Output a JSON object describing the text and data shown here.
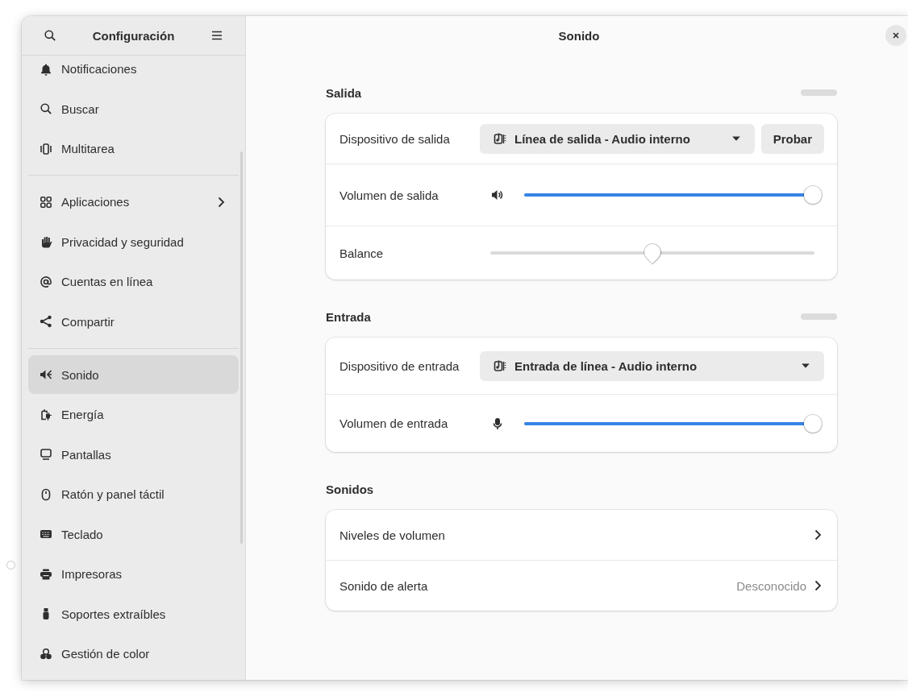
{
  "sidebar": {
    "title": "Configuración",
    "groups": [
      {
        "items": [
          {
            "label": "Notificaciones",
            "selected": false,
            "submenu": false
          },
          {
            "label": "Buscar",
            "selected": false,
            "submenu": false
          },
          {
            "label": "Multitarea",
            "selected": false,
            "submenu": false
          }
        ]
      },
      {
        "items": [
          {
            "label": "Aplicaciones",
            "selected": false,
            "submenu": true
          },
          {
            "label": "Privacidad y seguridad",
            "selected": false,
            "submenu": false
          },
          {
            "label": "Cuentas en línea",
            "selected": false,
            "submenu": false
          },
          {
            "label": "Compartir",
            "selected": false,
            "submenu": false
          }
        ]
      },
      {
        "items": [
          {
            "label": "Sonido",
            "selected": true,
            "submenu": false
          },
          {
            "label": "Energía",
            "selected": false,
            "submenu": false
          },
          {
            "label": "Pantallas",
            "selected": false,
            "submenu": false
          },
          {
            "label": "Ratón y panel táctil",
            "selected": false,
            "submenu": false
          },
          {
            "label": "Teclado",
            "selected": false,
            "submenu": false
          },
          {
            "label": "Impresoras",
            "selected": false,
            "submenu": false
          },
          {
            "label": "Soportes extraíbles",
            "selected": false,
            "submenu": false
          },
          {
            "label": "Gestión de color",
            "selected": false,
            "submenu": false
          }
        ]
      }
    ]
  },
  "page": {
    "title": "Sonido",
    "sections": [
      {
        "heading": "Salida",
        "meter": {
          "level": 0
        },
        "rows": [
          {
            "kind": "dropdown",
            "label": "Dispositivo de salida",
            "value": "Línea de salida - Audio interno",
            "button": "Probar"
          },
          {
            "kind": "slider",
            "label": "Volumen de salida",
            "level": 1
          },
          {
            "kind": "balance",
            "label": "Balance",
            "level": 0.5
          }
        ]
      },
      {
        "heading": "Entrada",
        "meter": {
          "level": 0
        },
        "rows": [
          {
            "kind": "dropdown",
            "label": "Dispositivo de entrada",
            "value": "Entrada de línea - Audio interno"
          },
          {
            "kind": "slider",
            "label": "Volumen de entrada",
            "level": 1
          }
        ]
      },
      {
        "heading": "Sonidos",
        "rows": [
          {
            "kind": "link",
            "label": "Niveles de volumen"
          },
          {
            "kind": "link",
            "label": "Sonido de alerta",
            "value": "Desconocido"
          }
        ]
      }
    ]
  }
}
